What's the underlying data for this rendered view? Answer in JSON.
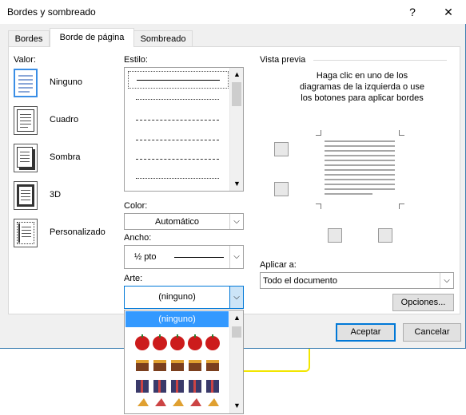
{
  "window": {
    "title": "Bordes y sombreado",
    "help_label": "?",
    "close_label": "✕"
  },
  "tabs": [
    {
      "label": "Bordes",
      "active": false
    },
    {
      "label": "Borde de página",
      "active": true
    },
    {
      "label": "Sombreado",
      "active": false
    }
  ],
  "setting": {
    "label": "Valor:",
    "options": [
      {
        "label": "Ninguno",
        "selected": true
      },
      {
        "label": "Cuadro",
        "selected": false
      },
      {
        "label": "Sombra",
        "selected": false
      },
      {
        "label": "3D",
        "selected": false
      },
      {
        "label": "Personalizado",
        "selected": false
      }
    ]
  },
  "style": {
    "label": "Estilo:"
  },
  "color": {
    "label": "Color:",
    "value": "Automático"
  },
  "width": {
    "label": "Ancho:",
    "value": "½ pto"
  },
  "art": {
    "label": "Arte:",
    "value": "(ninguno)",
    "dropdown_selected": "(ninguno)"
  },
  "preview": {
    "label": "Vista previa",
    "instruction": "Haga clic en uno de los diagramas de la izquierda o use los botones para aplicar bordes"
  },
  "apply_to": {
    "label": "Aplicar a:",
    "value": "Todo el documento"
  },
  "buttons": {
    "options": "Opciones...",
    "ok": "Aceptar",
    "cancel": "Cancelar"
  },
  "colors": {
    "accent": "#0078d7",
    "selection": "#3399ff",
    "highlight_outline": "#f2e600"
  }
}
